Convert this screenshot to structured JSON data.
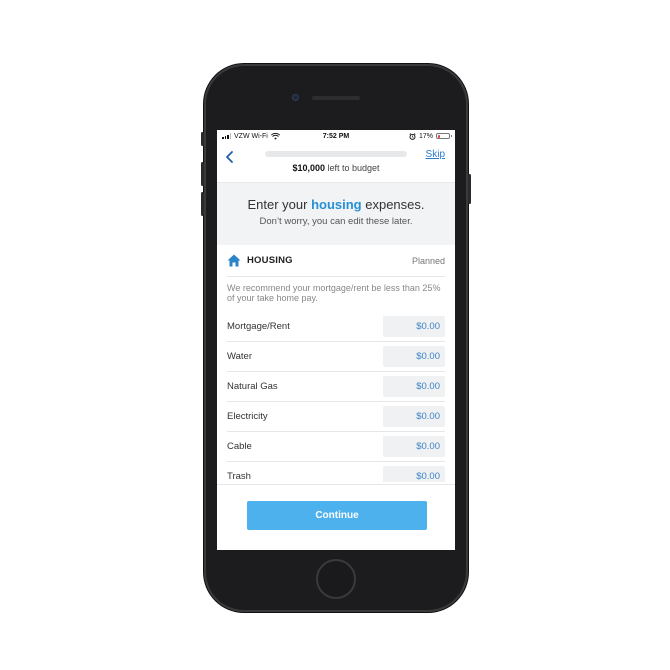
{
  "status_bar": {
    "carrier": "VZW Wi-Fi",
    "time": "7:52 PM",
    "battery": "17%",
    "battery_level": 0.17
  },
  "nav": {
    "skip_label": "Skip",
    "budget_amount": "$10,000",
    "budget_suffix": "left to budget"
  },
  "hero": {
    "title_prefix": "Enter your ",
    "title_highlight": "housing",
    "title_suffix": " expenses.",
    "subtitle": "Don’t worry, you can edit these later."
  },
  "group": {
    "title": "HOUSING",
    "column_label": "Planned",
    "advice": "We recommend your mortgage/rent be less than 25% of your take home pay."
  },
  "items": [
    {
      "label": "Mortgage/Rent",
      "amount": "$0.00"
    },
    {
      "label": "Water",
      "amount": "$0.00"
    },
    {
      "label": "Natural Gas",
      "amount": "$0.00"
    },
    {
      "label": "Electricity",
      "amount": "$0.00"
    },
    {
      "label": "Cable",
      "amount": "$0.00"
    },
    {
      "label": "Trash",
      "amount": "$0.00"
    }
  ],
  "footer": {
    "continue_label": "Continue"
  },
  "colors": {
    "accent": "#2590d6",
    "button": "#4db1ee",
    "amount_text": "#3a82c8",
    "nav_icon": "#1f5ea8"
  },
  "icons": [
    "back-chevron-icon",
    "wifi-icon",
    "alarm-icon",
    "battery-icon",
    "house-icon"
  ]
}
